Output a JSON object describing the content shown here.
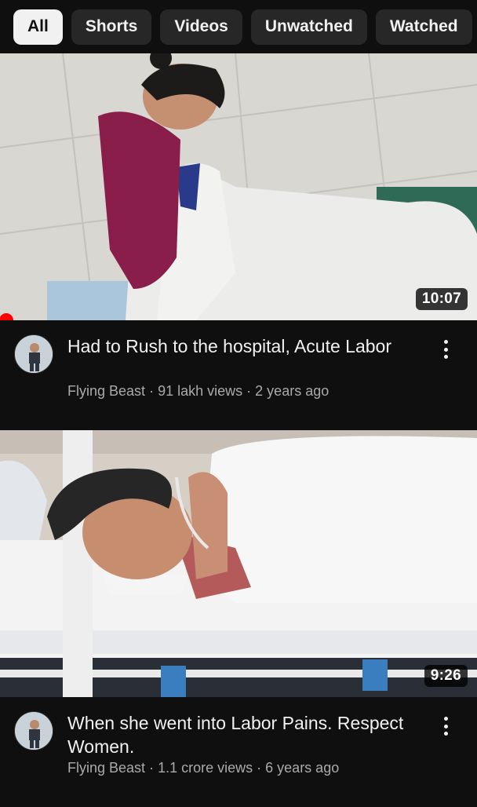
{
  "filters": [
    {
      "label": "All",
      "active": true
    },
    {
      "label": "Shorts",
      "active": false
    },
    {
      "label": "Videos",
      "active": false
    },
    {
      "label": "Unwatched",
      "active": false
    },
    {
      "label": "Watched",
      "active": false
    }
  ],
  "videos": [
    {
      "title": "Had to Rush to the hospital, Acute Labor",
      "channel": "Flying Beast",
      "views": "91 lakh views",
      "age": "2 years ago",
      "duration": "10:07",
      "watched_fraction": 0.01
    },
    {
      "title": "When she went into Labor Pains. Respect Women.",
      "channel": "Flying Beast",
      "views": "1.1 crore views",
      "age": "6 years ago",
      "duration": "9:26"
    }
  ],
  "separator": "·",
  "icons": {
    "more": "vertical-ellipsis-icon",
    "avatar": "channel-avatar"
  },
  "colors": {
    "background": "#0f0f0f",
    "chip_bg": "#272727",
    "chip_active_bg": "#f1f1f1",
    "progress": "#ff0000",
    "subtext": "#aaaaaa"
  }
}
